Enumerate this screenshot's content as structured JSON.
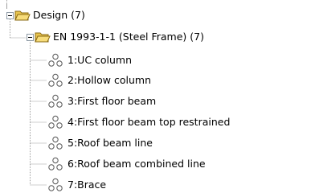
{
  "tree": {
    "root": {
      "label": "Design (7)",
      "icon": "folder-open-icon",
      "expander_icon": "collapse-minus-icon"
    },
    "group": {
      "label": "EN 1993-1-1 (Steel Frame) (7)",
      "icon": "folder-open-icon",
      "expander_icon": "collapse-minus-icon"
    },
    "items": [
      {
        "label": "1:UC column",
        "icon": "design-group-icon"
      },
      {
        "label": "2:Hollow column",
        "icon": "design-group-icon"
      },
      {
        "label": "3:First floor beam",
        "icon": "design-group-icon"
      },
      {
        "label": "4:First floor beam top restrained",
        "icon": "design-group-icon"
      },
      {
        "label": "5:Roof beam line",
        "icon": "design-group-icon"
      },
      {
        "label": "6:Roof beam combined line",
        "icon": "design-group-icon"
      },
      {
        "label": "7:Brace",
        "icon": "design-group-icon"
      }
    ]
  },
  "colors": {
    "folder_fill": "#f2d46a",
    "folder_stroke": "#8a6a12",
    "tree_line": "#a0a0a0",
    "icon_stroke": "#555555"
  }
}
